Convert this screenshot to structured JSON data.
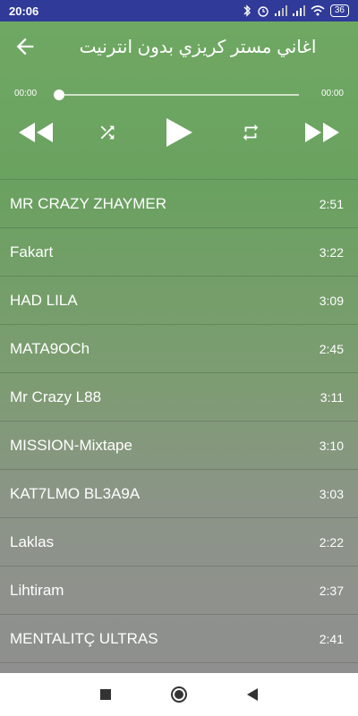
{
  "status": {
    "time": "20:06",
    "battery": "36"
  },
  "header": {
    "title": "اغاني مستر كريزي بدون انترنيت"
  },
  "player": {
    "current_time": "00:00",
    "total_time": "00:00",
    "progress": 0
  },
  "tracks": [
    {
      "name": "MR CRAZY ZHAYMER",
      "duration": "2:51"
    },
    {
      "name": "Fakart",
      "duration": "3:22"
    },
    {
      "name": "HAD LILA",
      "duration": "3:09"
    },
    {
      "name": "MATA9OCh",
      "duration": "2:45"
    },
    {
      "name": "Mr Crazy L88",
      "duration": "3:11"
    },
    {
      "name": "MISSION-Mixtape",
      "duration": "3:10"
    },
    {
      "name": "KAT7LMO BL3A9A",
      "duration": "3:03"
    },
    {
      "name": "Laklas",
      "duration": "2:22"
    },
    {
      "name": "Lihtiram",
      "duration": "2:37"
    },
    {
      "name": "MENTALITÇ ULTRAS",
      "duration": "2:41"
    }
  ],
  "colors": {
    "status_bar": "#2f3a99",
    "top_gradient": "#6fa863",
    "bottom_gradient": "#8f8f8f"
  },
  "icons": [
    "back-arrow-icon",
    "rewind-icon",
    "shuffle-icon",
    "play-icon",
    "repeat-icon",
    "fast-forward-icon",
    "bluetooth-icon",
    "alarm-icon",
    "signal-icon",
    "wifi-icon",
    "battery-icon",
    "nav-recents-icon",
    "nav-home-icon",
    "nav-back-icon"
  ]
}
